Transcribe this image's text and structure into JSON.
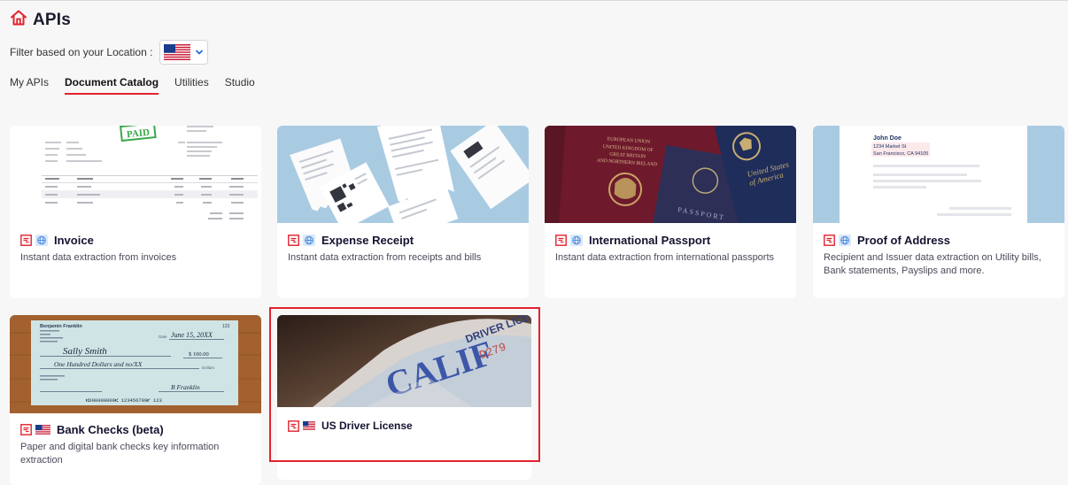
{
  "page": {
    "title": "APIs",
    "brand_color": "#e2222e"
  },
  "filter": {
    "label": "Filter based on your Location :",
    "selected_flag": "us-flag"
  },
  "tabs": [
    {
      "label": "My APIs",
      "active": false
    },
    {
      "label": "Document Catalog",
      "active": true
    },
    {
      "label": "Utilities",
      "active": false
    },
    {
      "label": "Studio",
      "active": false
    }
  ],
  "cards": [
    {
      "name": "Invoice",
      "region_icon": "globe-icon",
      "desc": "Instant data extraction from invoices",
      "image": {
        "stamp": "PAID"
      }
    },
    {
      "name": "Expense Receipt",
      "region_icon": "globe-icon",
      "desc": "Instant data extraction from receipts and bills"
    },
    {
      "name": "International Passport",
      "region_icon": "globe-icon",
      "desc": "Instant data extraction from international passports",
      "image": {
        "line1": "EUROPEAN UNION",
        "line2": "UNITED KINGDOM OF",
        "line3": "GREAT BRITAIN",
        "line4": "AND NORTHERN IRELAND",
        "passport": "PASSPORT",
        "us1": "United States",
        "us2": "of America"
      }
    },
    {
      "name": "Proof of Address",
      "region_icon": "globe-icon",
      "desc": "Recipient and Issuer data extraction on Utility bills, Bank statements, Payslips and more.",
      "image": {
        "addr_name": "John Doe",
        "addr_street": "1234 Market St",
        "addr_city": "San Francisco, CA 94105"
      }
    },
    {
      "name": "Bank Checks (beta)",
      "region_icon": "us-flag-icon",
      "desc": "Paper and digital bank checks key information extraction",
      "image": {
        "payer": "Benjamin Franklin",
        "check_no": "123",
        "date_label": "Date",
        "date": "June 15, 20XX",
        "payee": "Sally Smith",
        "amount": "$ 100.00",
        "words": "One Hundred Dollars and no/XX",
        "dollars": "Dollars",
        "signature": "B Franklin",
        "micr": "⑆000000000⑆  123456789⑈  123"
      }
    },
    {
      "name": "US Driver License",
      "region_icon": "us-flag-icon",
      "desc": "",
      "image": {
        "word1": "CALIF",
        "word2": "DRIVER LICE",
        "number": "D279"
      }
    }
  ]
}
